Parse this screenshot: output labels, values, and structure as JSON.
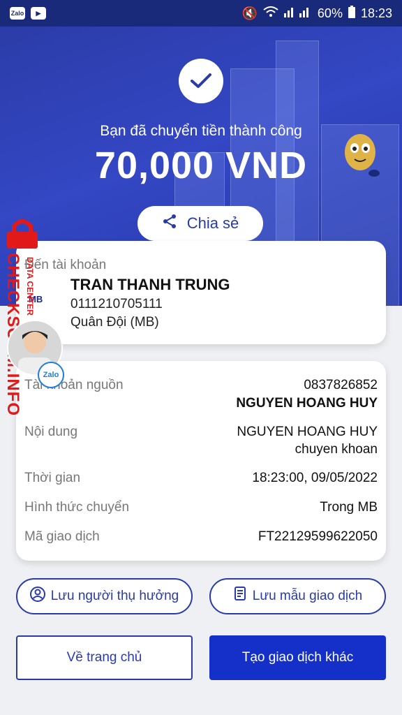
{
  "status_bar": {
    "battery": "60%",
    "time": "18:23",
    "app_icons": [
      "Zalo",
      "zalo-video"
    ]
  },
  "result": {
    "headline": "Bạn đã chuyển tiền thành công",
    "amount": "70,000 VND",
    "share_label": "Chia sẻ"
  },
  "recipient": {
    "label": "Đến tài khoản",
    "name": "TRAN THANH TRUNG",
    "account": "0111210705111",
    "bank": "Quân Đội (MB)",
    "bank_logo": "MB"
  },
  "details": {
    "source_label": "Tài khoản nguồn",
    "source_account": "0837826852",
    "source_name": "NGUYEN HOANG HUY",
    "content_label": "Nội dung",
    "content_line1": "NGUYEN HOANG HUY",
    "content_line2": "chuyen khoan",
    "time_label": "Thời gian",
    "time_value": "18:23:00, 09/05/2022",
    "method_label": "Hình thức chuyển",
    "method_value": "Trong MB",
    "txn_label": "Mã giao dịch",
    "txn_value": "FT22129599622050"
  },
  "actions": {
    "save_beneficiary": "Lưu người thụ hưởng",
    "save_template": "Lưu mẫu giao dịch",
    "home": "Về trang chủ",
    "new_transaction": "Tạo giao dịch khác"
  },
  "overlay": {
    "watermark": "CHECKSCAM.INFO",
    "watermark_sub": "DATA CENTER",
    "zalo_badge": "Zalo"
  },
  "colors": {
    "primary": "#2a3aa8",
    "button_fill": "#1530c8",
    "hero": "#3447c4"
  }
}
